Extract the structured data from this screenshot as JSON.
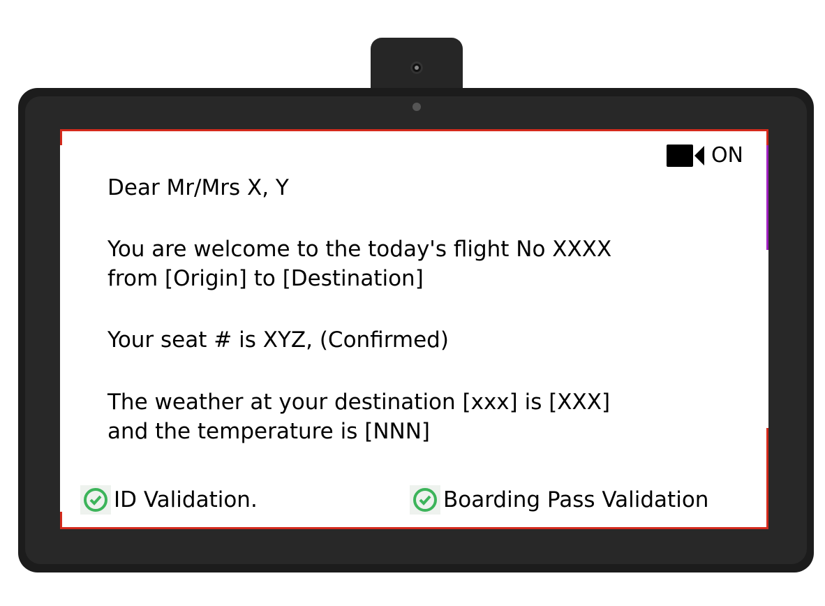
{
  "camera": {
    "icon": "video-camera-icon",
    "status": "ON"
  },
  "message": {
    "greeting": "Dear Mr/Mrs X, Y",
    "welcome_line1": "You are welcome to the today's flight No XXXX",
    "welcome_line2": "from [Origin] to [Destination]",
    "seat": "Your seat # is XYZ, (Confirmed)",
    "weather_line1": "The weather at your destination [xxx] is [XXX]",
    "weather_line2": "and the temperature is [NNN]"
  },
  "validations": [
    {
      "label": "ID Validation.",
      "icon": "check-circle-icon",
      "status": "passed"
    },
    {
      "label": "Boarding Pass Validation",
      "icon": "check-circle-icon",
      "status": "passed"
    }
  ],
  "colors": {
    "border": "#d42a1c",
    "accent_purple": "#a020c0",
    "check": "#3cb45a"
  }
}
